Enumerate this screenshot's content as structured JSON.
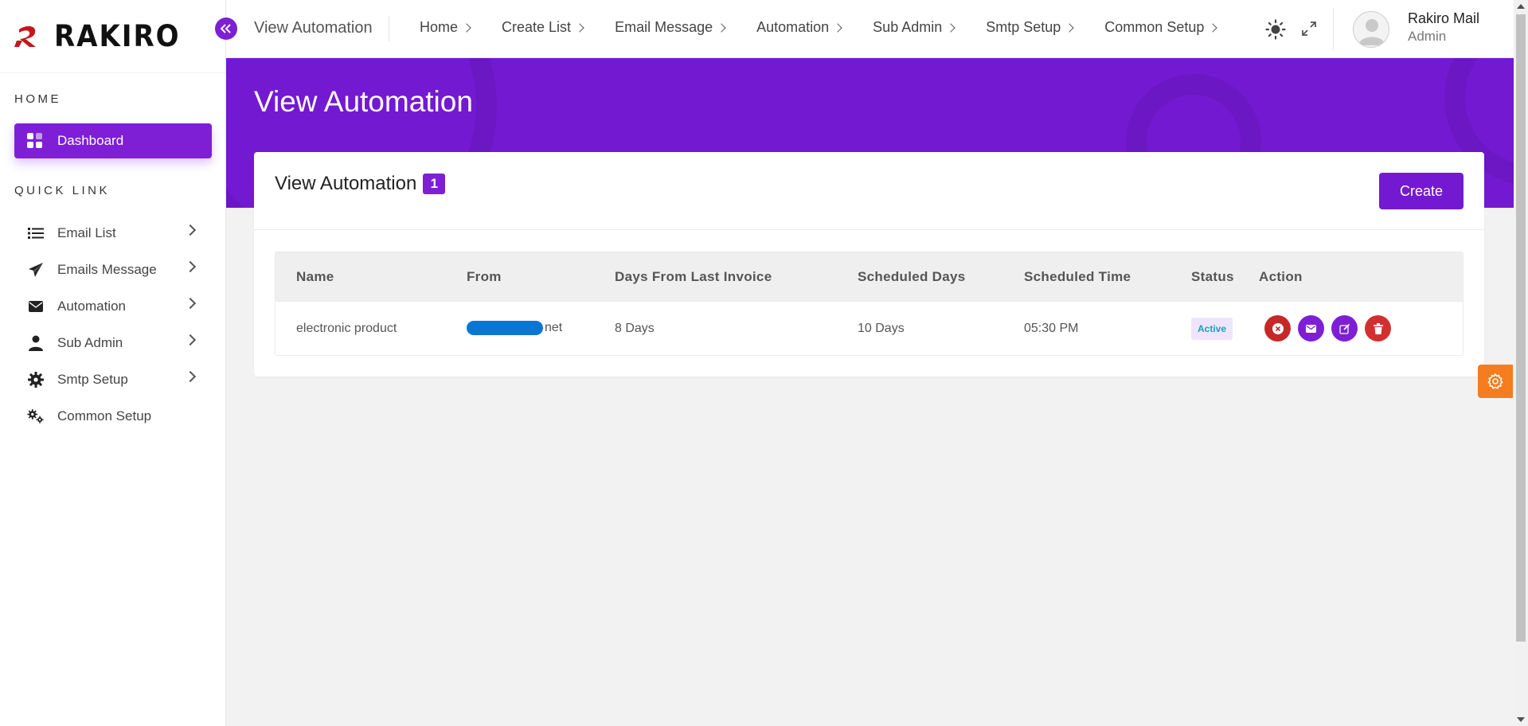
{
  "brand": {
    "name": "RAKIRO",
    "accent": "#7419d2"
  },
  "sidebar": {
    "home_heading": "HOME",
    "dashboard_label": "Dashboard",
    "quick_heading": "QUICK LINK",
    "items": [
      {
        "label": "Email List",
        "icon": "list-icon",
        "has_chevron": true
      },
      {
        "label": "Emails Message",
        "icon": "paper-plane-icon",
        "has_chevron": true
      },
      {
        "label": "Automation",
        "icon": "envelope-icon",
        "has_chevron": true
      },
      {
        "label": "Sub Admin",
        "icon": "user-icon",
        "has_chevron": true
      },
      {
        "label": "Smtp Setup",
        "icon": "gear-icon",
        "has_chevron": true
      },
      {
        "label": "Common Setup",
        "icon": "gears-icon",
        "has_chevron": false
      }
    ]
  },
  "topbar": {
    "page_name": "View Automation",
    "nav": [
      "Home",
      "Create List",
      "Email Message",
      "Automation",
      "Sub Admin",
      "Smtp Setup",
      "Common Setup"
    ],
    "user_name": "Rakiro Mail",
    "user_role": "Admin"
  },
  "header": {
    "title": "View Automation"
  },
  "card": {
    "title": "View Automation",
    "count": "1",
    "create_label": "Create",
    "columns": [
      "Name",
      "From",
      "Days From Last Invoice",
      "Scheduled Days",
      "Scheduled Time",
      "Status",
      "Action"
    ],
    "rows": [
      {
        "name": "electronic product",
        "from_suffix": "net",
        "days_from_last_invoice": "8 Days",
        "scheduled_days": "10 Days",
        "scheduled_time": "05:30 PM",
        "status": "Active"
      }
    ]
  }
}
